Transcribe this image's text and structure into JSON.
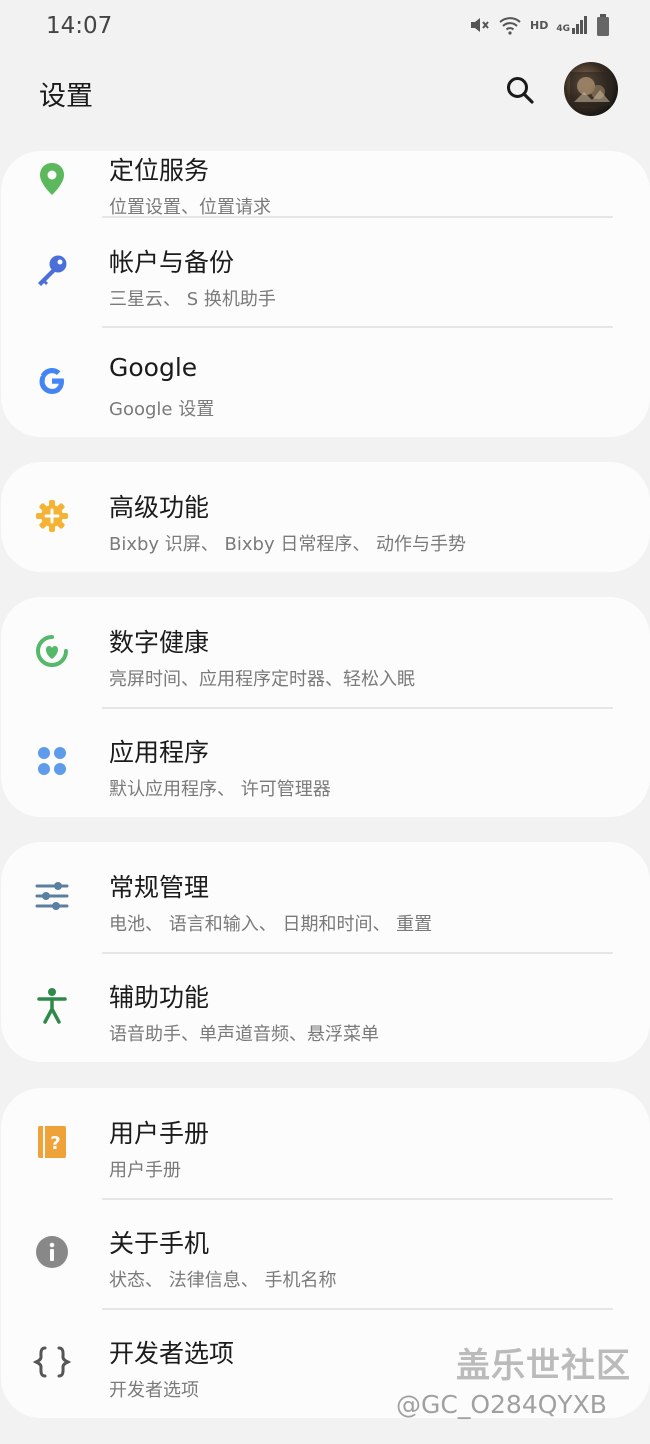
{
  "status_bar": {
    "time": "14:07",
    "network_hd": "HD",
    "network_gen": "4G"
  },
  "header": {
    "title": "设置"
  },
  "cards": [
    {
      "items": [
        {
          "title": "定位服务",
          "subtitle": "位置设置、位置请求",
          "icon": "location-pin-icon"
        },
        {
          "title": "帐户与备份",
          "subtitle": "三星云、 S 换机助手",
          "icon": "key-icon"
        },
        {
          "title": "Google",
          "subtitle": "Google 设置",
          "icon": "google-icon"
        }
      ]
    },
    {
      "items": [
        {
          "title": "高级功能",
          "subtitle": "Bixby 识屏、 Bixby 日常程序、 动作与手势",
          "icon": "gear-plus-icon"
        }
      ]
    },
    {
      "items": [
        {
          "title": "数字健康",
          "subtitle": "亮屏时间、应用程序定时器、轻松入眠",
          "icon": "heart-ring-icon"
        },
        {
          "title": "应用程序",
          "subtitle": "默认应用程序、 许可管理器",
          "icon": "apps-grid-icon"
        }
      ]
    },
    {
      "items": [
        {
          "title": "常规管理",
          "subtitle": "电池、 语言和输入、 日期和时间、 重置",
          "icon": "sliders-icon"
        },
        {
          "title": "辅助功能",
          "subtitle": "语音助手、单声道音频、悬浮菜单",
          "icon": "accessibility-icon"
        }
      ]
    },
    {
      "items": [
        {
          "title": "用户手册",
          "subtitle": "用户手册",
          "icon": "help-book-icon"
        },
        {
          "title": "关于手机",
          "subtitle": "状态、 法律信息、 手机名称",
          "icon": "info-icon"
        },
        {
          "title": "开发者选项",
          "subtitle": "开发者选项",
          "icon": "braces-icon"
        }
      ]
    }
  ],
  "watermark": {
    "brand": "盖乐世社区",
    "user": "@GC_O284QYXB"
  },
  "colors": {
    "background": "#f2f2f2",
    "card": "#fcfcfc",
    "location": "#5cb85c",
    "key": "#4a6fd8",
    "google": "#4285f4",
    "advanced": "#f5b335",
    "wellbeing": "#55b86a",
    "apps": "#5e9be8",
    "general": "#5b7fa0",
    "accessibility": "#2f8a4a",
    "manual": "#f0a23a",
    "info": "#888888",
    "developer": "#555555"
  }
}
